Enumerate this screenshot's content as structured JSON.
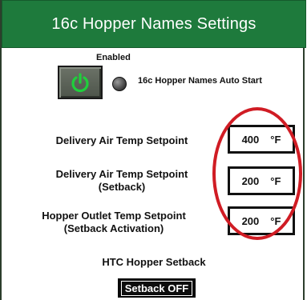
{
  "title": "16c Hopper Names Settings",
  "enable": {
    "label": "Enabled",
    "indicator_label": "16c Hopper Names Auto Start",
    "button_icon": "power-icon"
  },
  "setpoints": [
    {
      "label_line1": "Delivery Air Temp Setpoint",
      "label_line2": "",
      "value": "400",
      "unit": "°F"
    },
    {
      "label_line1": "Delivery Air Temp Setpoint",
      "label_line2": "(Setback)",
      "value": "200",
      "unit": "°F"
    },
    {
      "label_line1": "Hopper Outlet Temp Setpoint",
      "label_line2": "(Setback Activation)",
      "value": "200",
      "unit": "°F"
    }
  ],
  "setback": {
    "section_title": "HTC Hopper Setback",
    "button_label": "Setback OFF"
  },
  "colors": {
    "title_bar": "#1e7a3c",
    "power_icon": "#1fcf3c",
    "annotation": "#d01c24"
  }
}
